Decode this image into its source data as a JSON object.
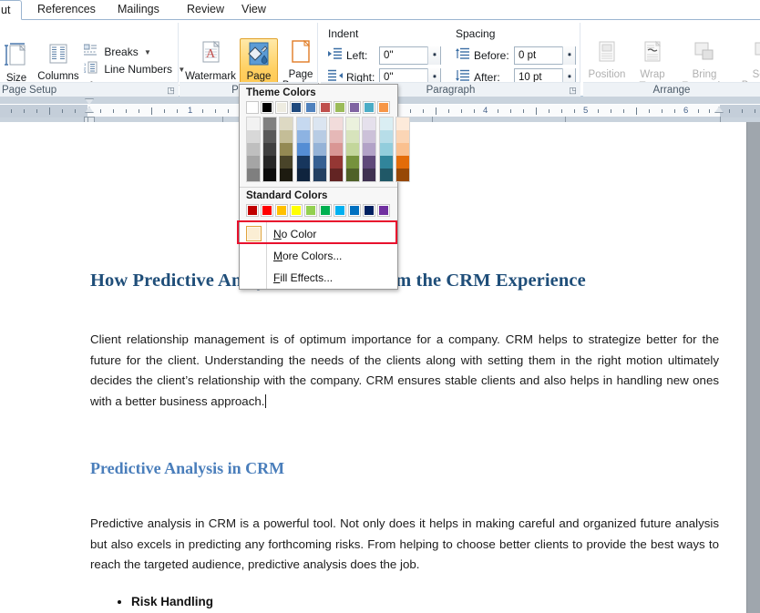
{
  "window": {
    "app": "Microsoft Word",
    "ribbon_tabs": [
      {
        "label": "ut",
        "active": true
      },
      {
        "label": "References",
        "active": false
      },
      {
        "label": "Mailings",
        "active": false
      },
      {
        "label": "Review",
        "active": false
      },
      {
        "label": "View",
        "active": false
      }
    ]
  },
  "ribbon": {
    "groups": [
      {
        "name": "Page Setup",
        "label": "Page Setup",
        "has_launcher": true
      },
      {
        "name": "Page Background",
        "label": "Page B",
        "has_launcher": false
      },
      {
        "name": "Paragraph",
        "label": "Paragraph",
        "has_launcher": true
      },
      {
        "name": "Arrange",
        "label": "Arrange",
        "has_launcher": false
      }
    ],
    "page_setup": {
      "size_label": "Size",
      "columns_label": "Columns",
      "breaks_label": "Breaks",
      "line_numbers_label": "Line Numbers",
      "hyphenation_label": "Hyphenation"
    },
    "page_background": {
      "watermark_label": "Watermark",
      "page_color_label_line1": "Page",
      "page_color_label_line2": "Color",
      "page_borders_label_line1": "Page",
      "page_borders_label_line2": "Borders",
      "page_color_active": true,
      "highlight_color": "#ffd062"
    },
    "paragraph": {
      "indent_header": "Indent",
      "spacing_header": "Spacing",
      "indent_left_label": "Left:",
      "indent_left_value": "0\"",
      "indent_right_label": "Right:",
      "indent_right_value": "0\"",
      "spacing_before_label": "Before:",
      "spacing_before_value": "0 pt",
      "spacing_after_label": "After:",
      "spacing_after_value": "10 pt"
    },
    "arrange": {
      "position_label": "Position",
      "wrap_text_label_line1": "Wrap",
      "wrap_text_label_line2": "Text",
      "bring_forward_label_line1": "Bring",
      "bring_forward_label_line2": "Forward",
      "send_backward_label_line1": "Send",
      "send_backward_label_line2": "Backward",
      "disabled": true
    }
  },
  "ruler": {
    "numbers": [
      "1",
      "4",
      "5",
      "6"
    ],
    "unit": "inch"
  },
  "color_menu": {
    "theme_header": "Theme Colors",
    "standard_header": "Standard Colors",
    "theme_top": [
      "#ffffff",
      "#000000",
      "#eeece1",
      "#1f497d",
      "#4f81bd",
      "#c0504d",
      "#9bbb59",
      "#8064a2",
      "#4bacc6",
      "#f79646"
    ],
    "theme_shades": [
      [
        "#f2f2f2",
        "#d8d8d8",
        "#bfbfbf",
        "#a5a5a5",
        "#7f7f7f"
      ],
      [
        "#7f7f7f",
        "#595959",
        "#3f3f3f",
        "#262626",
        "#0c0c0c"
      ],
      [
        "#ddd9c3",
        "#c4bd97",
        "#938953",
        "#494429",
        "#1d1b10"
      ],
      [
        "#c6d9f0",
        "#8db3e2",
        "#548dd4",
        "#17365d",
        "#0f243e"
      ],
      [
        "#dbe5f1",
        "#b8cce4",
        "#95b3d7",
        "#366092",
        "#244061"
      ],
      [
        "#f2dcdb",
        "#e5b8b7",
        "#d99694",
        "#953734",
        "#632423"
      ],
      [
        "#ebf1dd",
        "#d7e3bc",
        "#c3d69b",
        "#76923c",
        "#4f6128"
      ],
      [
        "#e5e0ec",
        "#ccc1d9",
        "#b2a2c7",
        "#5f497a",
        "#3f3151"
      ],
      [
        "#daeef3",
        "#b7dde8",
        "#92cddc",
        "#31859b",
        "#205867"
      ],
      [
        "#fdeada",
        "#fbd5b5",
        "#fac08f",
        "#e36c09",
        "#974806"
      ]
    ],
    "standard": [
      "#c00000",
      "#ff0000",
      "#ffc000",
      "#ffff00",
      "#92d050",
      "#00b050",
      "#00b0f0",
      "#0070c0",
      "#002060",
      "#7030a0"
    ],
    "items": [
      {
        "name": "no-color",
        "label": "No Color",
        "accesskey": "N",
        "highlighted": true
      },
      {
        "name": "more-colors",
        "label": "More Colors...",
        "accesskey": "M",
        "highlighted": false
      },
      {
        "name": "fill-effects",
        "label": "Fill Effects...",
        "accesskey": "F",
        "highlighted": false
      }
    ],
    "highlight_border_color": "#e8112d"
  },
  "document": {
    "title": "How Predictive Analysis will Transform the CRM Experience",
    "title_color": "#1f4e79",
    "paragraph1": "Client relationship management is of optimum importance for a company. CRM helps to strategize better for the future for the client. Understanding the needs of the clients along with setting them in the right motion ultimately decides the client’s relationship with the company. CRM ensures stable clients and also helps in handling new ones with a better business approach.",
    "heading2": "Predictive Analysis in CRM",
    "heading2_color": "#4a7ebb",
    "paragraph2": "Predictive analysis in CRM is a powerful tool. Not only does it helps in making careful and organized future analysis but also excels in predicting any forthcoming risks. From helping to choose better clients to provide the best ways to reach the targeted audience, predictive analysis does the job.",
    "bullets": [
      "Risk Handling"
    ]
  }
}
